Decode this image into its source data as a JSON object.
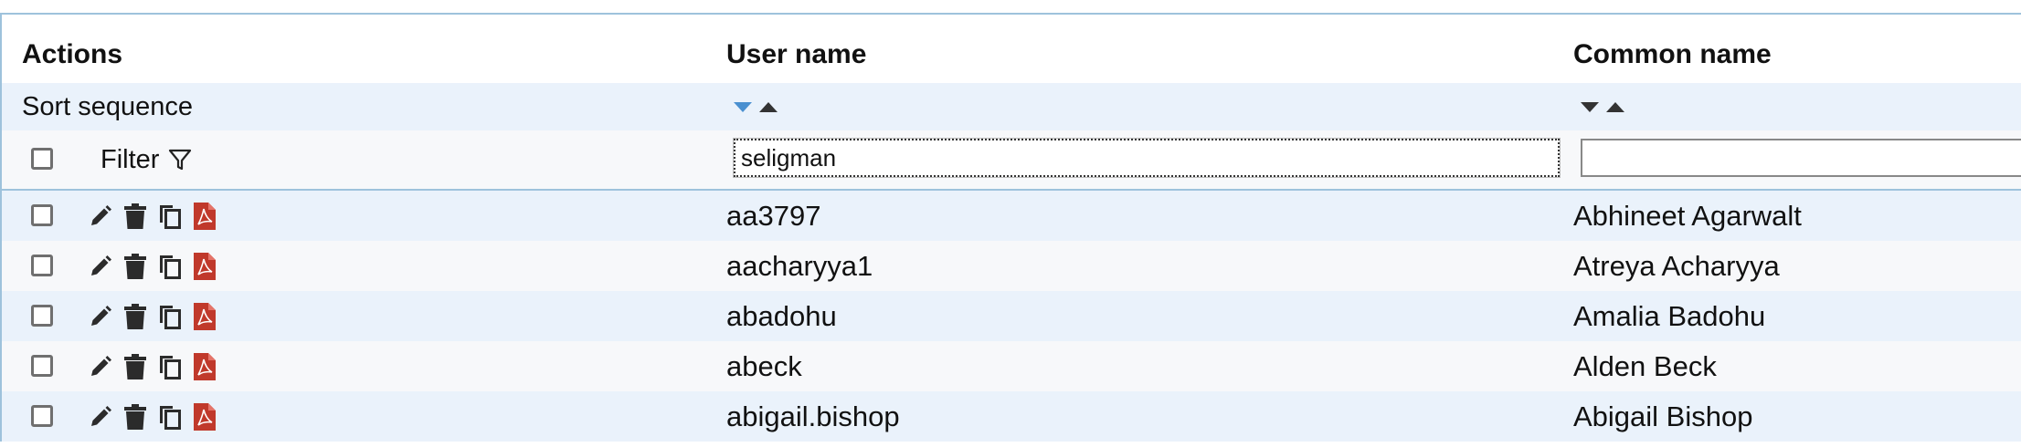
{
  "header": {
    "actions": "Actions",
    "user_name": "User name",
    "common_name": "Common name"
  },
  "sort": {
    "label": "Sort sequence",
    "user_name_active": "ascending"
  },
  "filter": {
    "label": "Filter",
    "user_name_value": "seligman",
    "common_name_value": ""
  },
  "icons": [
    "edit-icon",
    "delete-icon",
    "copy-icon",
    "pdf-icon",
    "filter-icon"
  ],
  "colors": {
    "row_alt": "#eaf2fb",
    "row_base": "#f7f8fa",
    "border": "#9ec2dc",
    "sort_active": "#4a90d0",
    "pdf_red": "#c0392b"
  },
  "rows": [
    {
      "user_name": "aa3797",
      "common_name": "Abhineet Agarwalt"
    },
    {
      "user_name": "aacharyya1",
      "common_name": "Atreya Acharyya"
    },
    {
      "user_name": "abadohu",
      "common_name": "Amalia Badohu"
    },
    {
      "user_name": "abeck",
      "common_name": "Alden Beck"
    },
    {
      "user_name": "abigail.bishop",
      "common_name": "Abigail Bishop"
    }
  ]
}
